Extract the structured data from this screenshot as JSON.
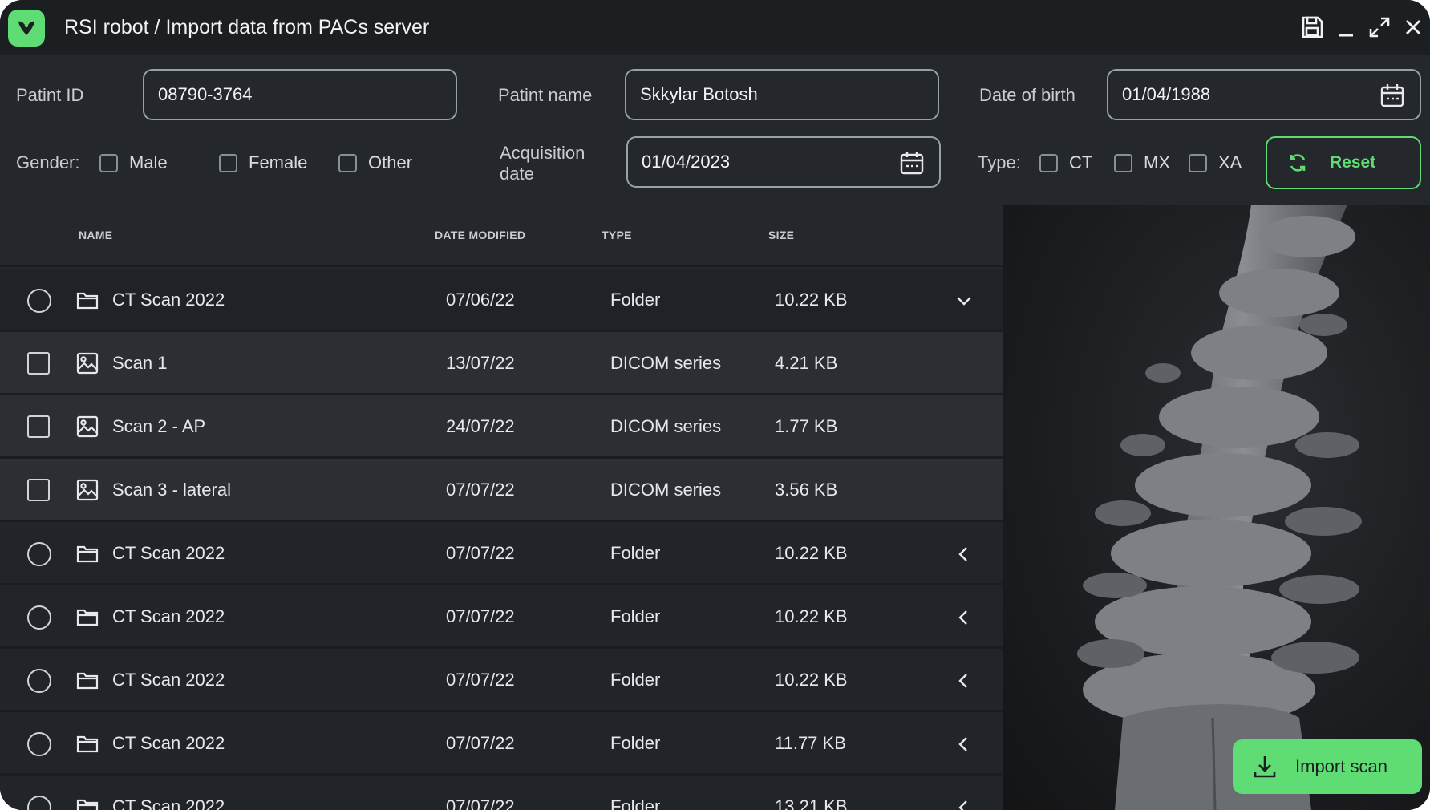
{
  "window": {
    "title": "RSI robot / Import data from PACs server",
    "accent_color": "#5fdc73",
    "background_color": "#24272b"
  },
  "form": {
    "patient_id": {
      "label": "Patint ID",
      "value": "08790-3764"
    },
    "patient_name": {
      "label": "Patint name",
      "value": "Skkylar Botosh"
    },
    "date_of_birth": {
      "label": "Date of birth",
      "value": "01/04/1988"
    },
    "gender": {
      "label": "Gender:",
      "options": [
        {
          "label": "Male",
          "checked": false
        },
        {
          "label": "Female",
          "checked": false
        },
        {
          "label": "Other",
          "checked": false
        }
      ]
    },
    "acquisition_date": {
      "label_line1": "Acquisition",
      "label_line2": "date",
      "value": "01/04/2023"
    },
    "type": {
      "label": "Type:",
      "options": [
        {
          "label": "CT",
          "checked": false
        },
        {
          "label": "MX",
          "checked": false
        },
        {
          "label": "XA",
          "checked": false
        }
      ]
    },
    "reset_label": "Reset"
  },
  "table": {
    "columns": {
      "name": "NAME",
      "date_modified": "DATE MODIFIED",
      "type": "TYPE",
      "size": "SIZE"
    },
    "rows": [
      {
        "kind": "folder",
        "name": "CT Scan 2022",
        "date": "07/06/22",
        "type": "Folder",
        "size": "10.22 KB",
        "expanded": true
      },
      {
        "kind": "dicom",
        "name": "Scan 1",
        "date": "13/07/22",
        "type": "DICOM series",
        "size": "4.21 KB"
      },
      {
        "kind": "dicom",
        "name": "Scan 2 - AP",
        "date": "24/07/22",
        "type": "DICOM series",
        "size": "1.77 KB"
      },
      {
        "kind": "dicom",
        "name": "Scan 3 - lateral",
        "date": "07/07/22",
        "type": "DICOM series",
        "size": "3.56 KB"
      },
      {
        "kind": "folder",
        "name": "CT Scan 2022",
        "date": "07/07/22",
        "type": "Folder",
        "size": "10.22 KB",
        "expanded": false
      },
      {
        "kind": "folder",
        "name": "CT Scan 2022",
        "date": "07/07/22",
        "type": "Folder",
        "size": "10.22 KB",
        "expanded": false
      },
      {
        "kind": "folder",
        "name": "CT Scan 2022",
        "date": "07/07/22",
        "type": "Folder",
        "size": "10.22 KB",
        "expanded": false
      },
      {
        "kind": "folder",
        "name": "CT Scan 2022",
        "date": "07/07/22",
        "type": "Folder",
        "size": "11.77 KB",
        "expanded": false
      },
      {
        "kind": "folder",
        "name": "CT Scan 2022",
        "date": "07/07/22",
        "type": "Folder",
        "size": "13.21 KB",
        "expanded": false
      }
    ]
  },
  "preview": {
    "import_label": "Import scan"
  }
}
